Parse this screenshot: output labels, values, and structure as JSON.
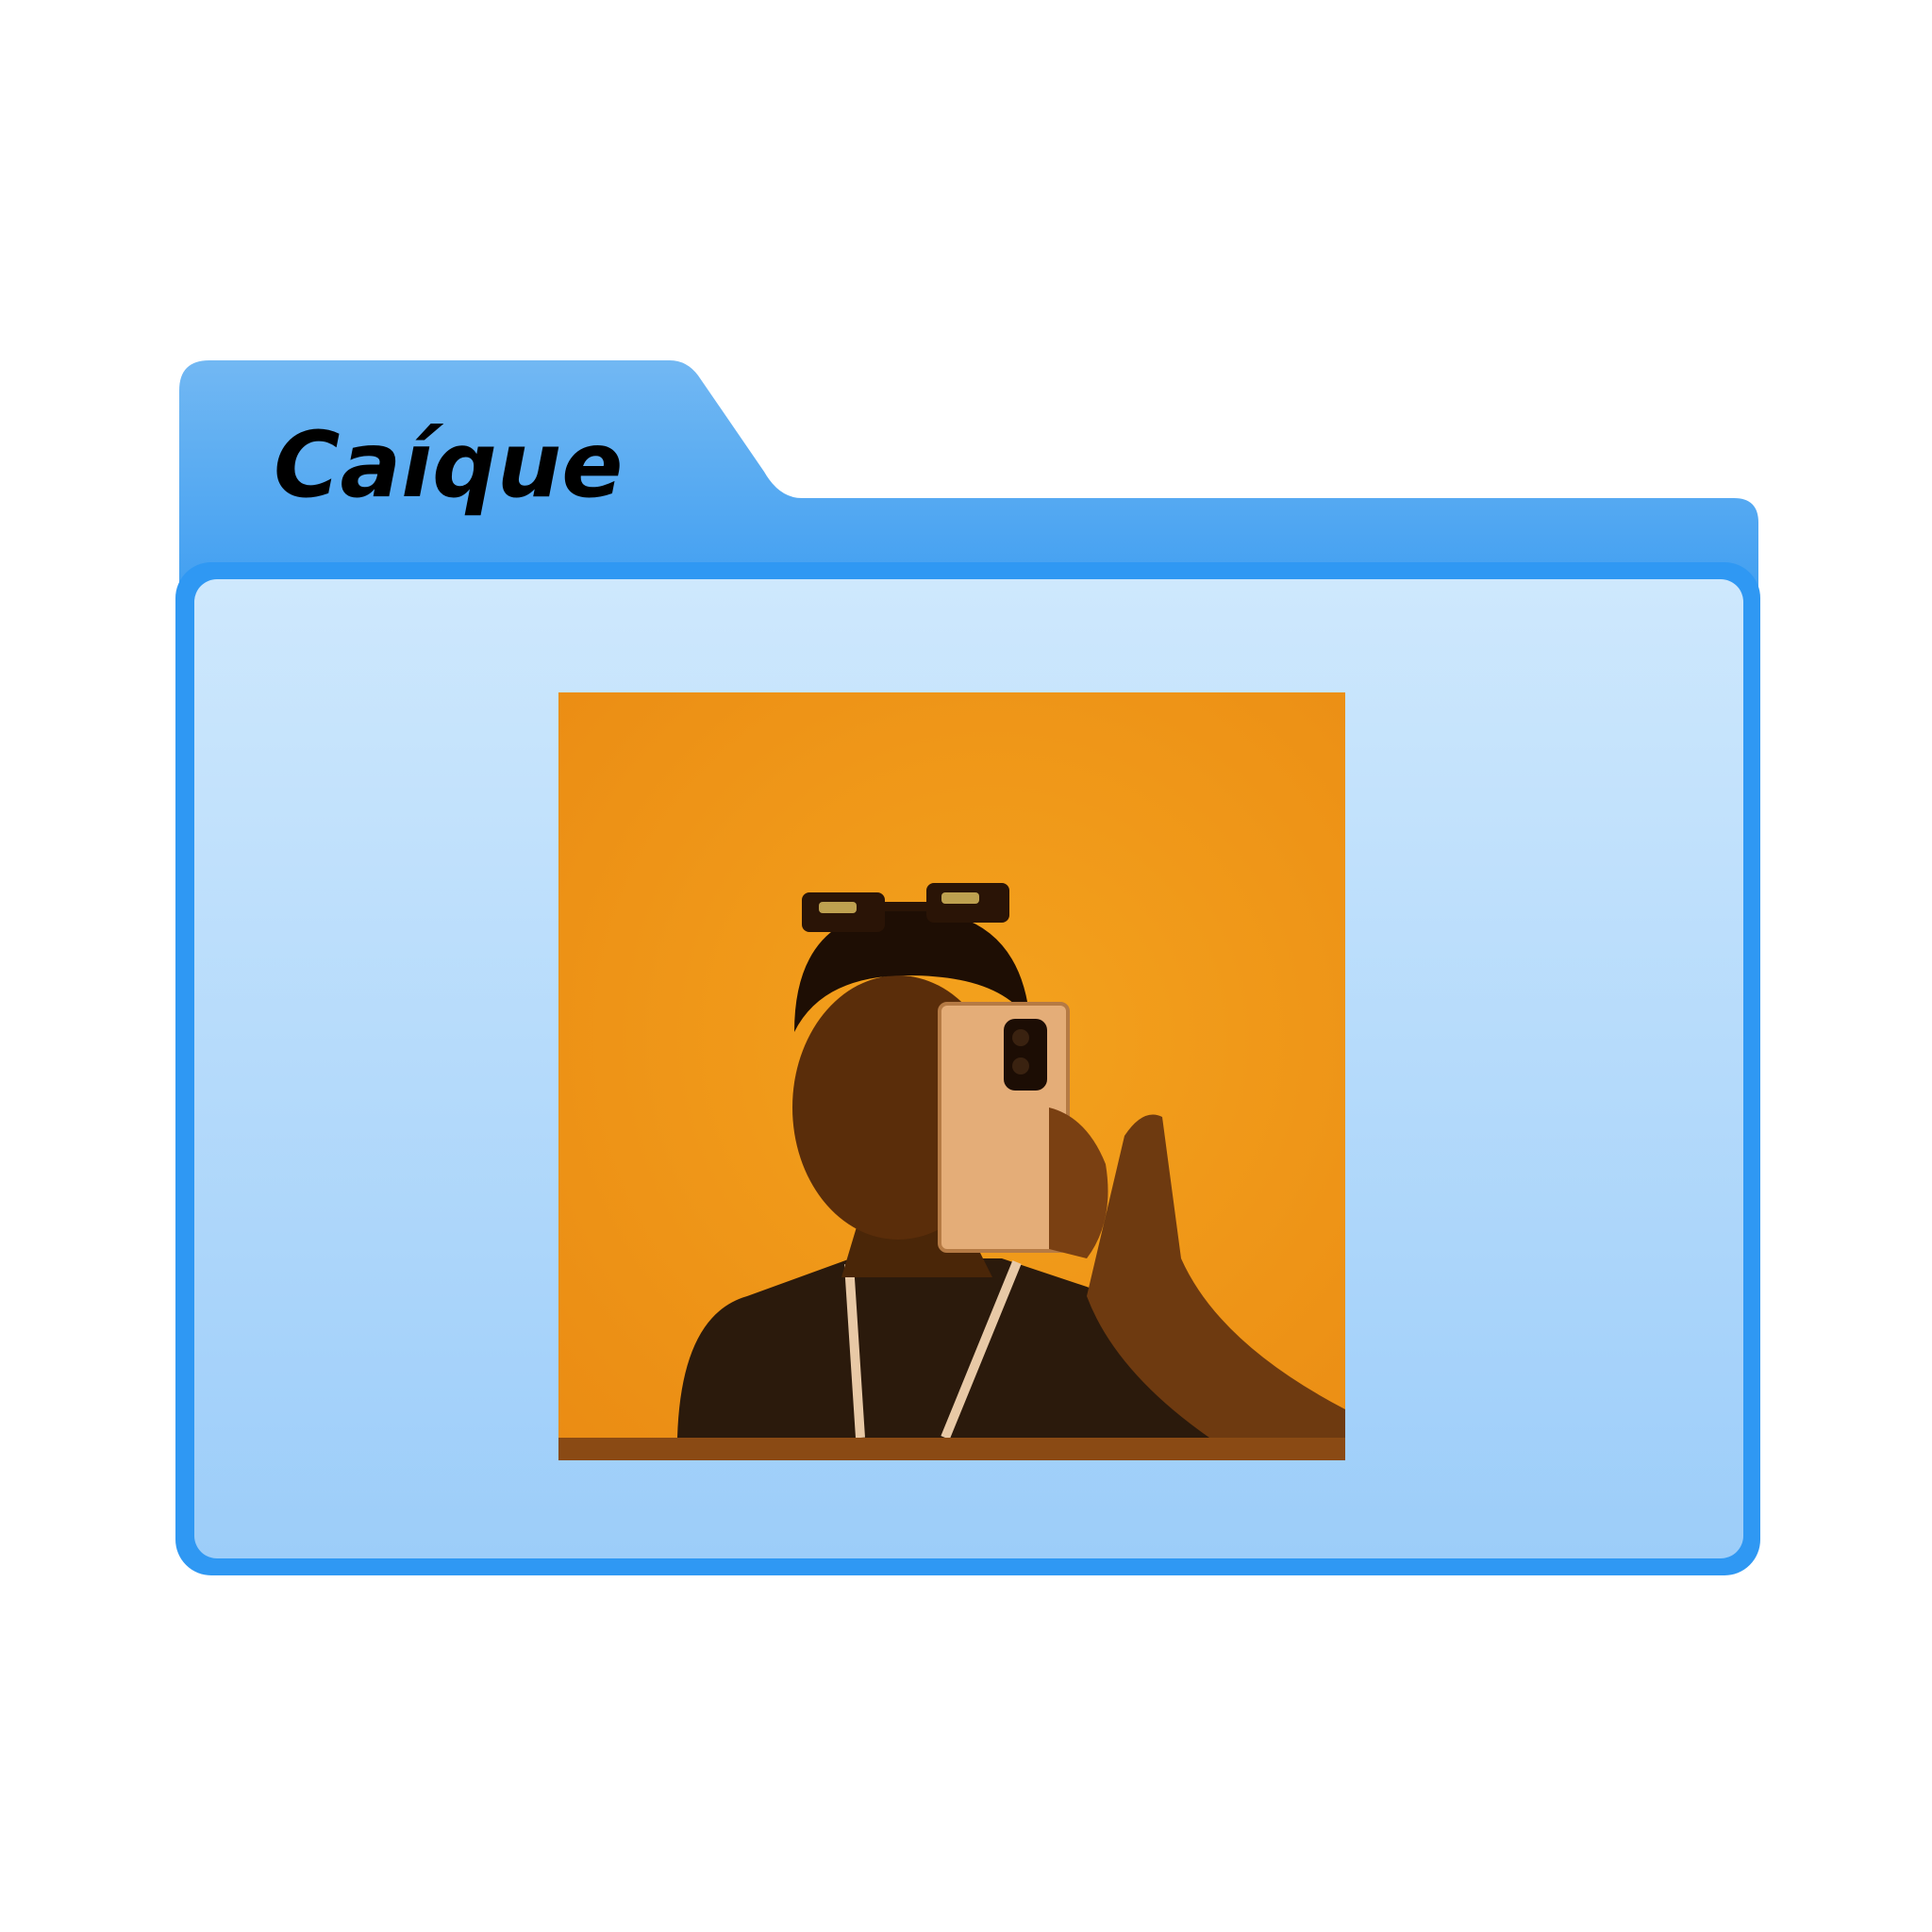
{
  "folder": {
    "title": "Caíque",
    "icon": "folder-icon",
    "colors": {
      "tab_top": "#6fb7f3",
      "tab_bottom": "#42a0f2",
      "border": "#2f98f3",
      "panel_top": "#cde7fd",
      "panel_bottom": "#9dcef9"
    }
  },
  "photo": {
    "kind": "mirror-selfie",
    "colors": {
      "wall": "#f39a1c",
      "shadow": "#2a1406",
      "phone": "#e6b27e"
    }
  }
}
